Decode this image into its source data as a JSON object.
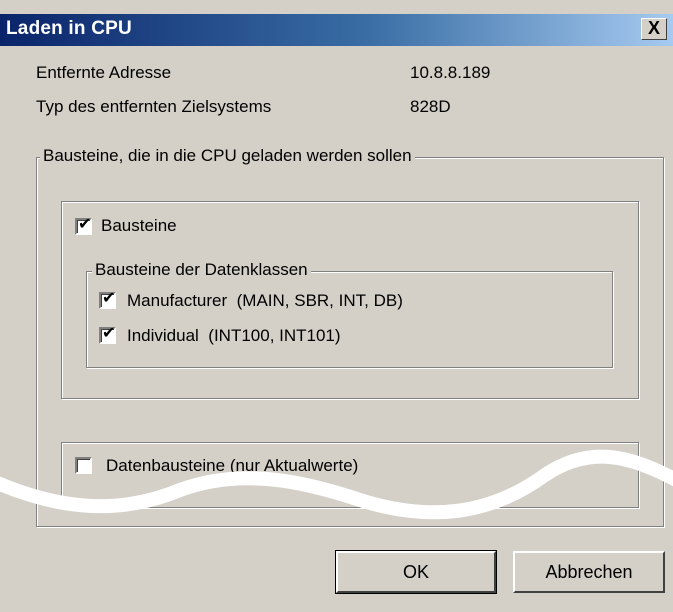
{
  "window": {
    "title": "Laden in CPU",
    "close_glyph": "X"
  },
  "info": {
    "remote_address_label": "Entfernte Adresse",
    "remote_address_value": "10.8.8.189",
    "target_type_label": "Typ des entfernten Zielsystems",
    "target_type_value": "828D"
  },
  "blocks_group": {
    "legend": "Bausteine, die in die CPU geladen werden sollen",
    "bausteine": {
      "label": "Bausteine",
      "checked": true
    },
    "dataclass_group": {
      "legend": "Bausteine der Datenklassen",
      "items": [
        {
          "label": "Manufacturer",
          "detail": "(MAIN, SBR, INT, DB)",
          "checked": true
        },
        {
          "label": "Individual",
          "detail": "(INT100, INT101)",
          "checked": true
        }
      ]
    }
  },
  "datablocks": {
    "label": "Datenbausteine (nur Aktualwerte)",
    "checked": false
  },
  "buttons": {
    "ok": "OK",
    "cancel": "Abbrechen"
  },
  "check_glyph": "✔"
}
